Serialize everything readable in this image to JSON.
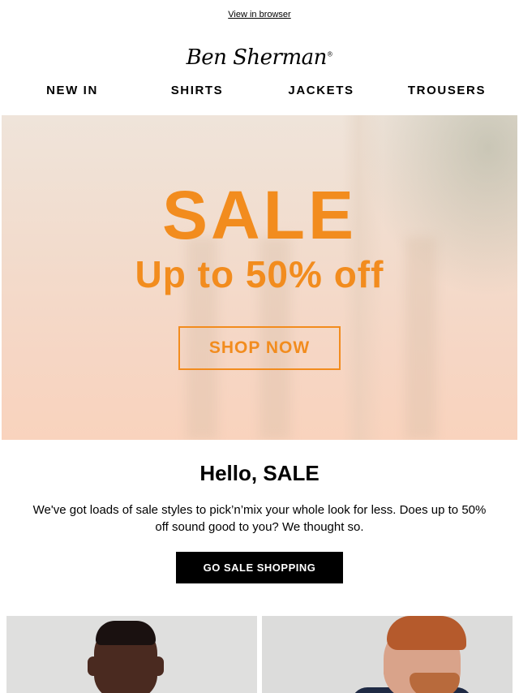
{
  "topbar": {
    "view_in_browser": "View in browser"
  },
  "brand": {
    "logo_text": "Ben Sherman",
    "registered": "®"
  },
  "nav": {
    "items": [
      "NEW IN",
      "SHIRTS",
      "JACKETS",
      "TROUSERS"
    ]
  },
  "hero": {
    "title": "SALE",
    "subtitle": "Up to 50% off",
    "button_label": "SHOP NOW",
    "accent_color": "#f28c1e"
  },
  "intro": {
    "heading": "Hello, SALE",
    "body": "We've got loads of sale styles to pick’n’mix your whole look for less. Does up to 50% off sound good to you? We thought so.",
    "cta_label": "GO SALE SHOPPING"
  },
  "products": {
    "items": [
      {
        "icon": "model-photo"
      },
      {
        "icon": "model-photo"
      }
    ]
  }
}
